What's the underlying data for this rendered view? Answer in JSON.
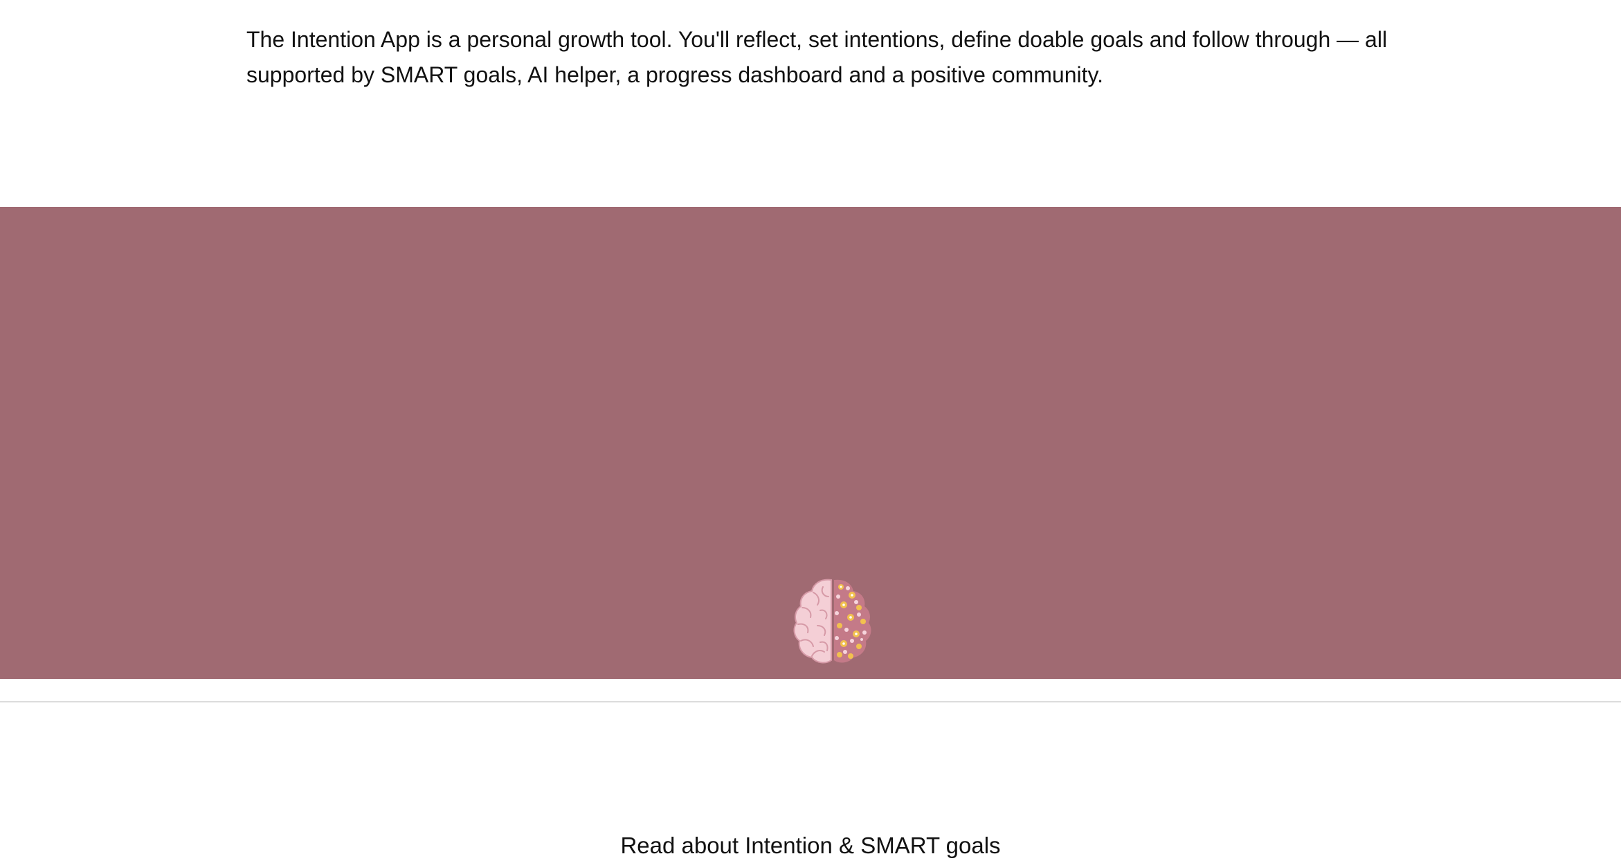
{
  "intro": {
    "text": "The Intention App is a personal growth tool. You'll reflect, set intentions, define doable goals and follow through — all supported by SMART goals, AI helper, a progress dashboard and a positive community."
  },
  "banner": {
    "background_color": "#a06a72",
    "illustration_icon": "brain-flowers-icon",
    "link_label": "Read about Intention & SMART goals"
  },
  "colors": {
    "brain_left": "#f4cfd6",
    "brain_outline": "#d69aa7",
    "brain_right": "#c47a88",
    "flower_yellow": "#f2c14e",
    "flower_pink": "#f6d4dc",
    "divider": "#dcdcdc"
  }
}
